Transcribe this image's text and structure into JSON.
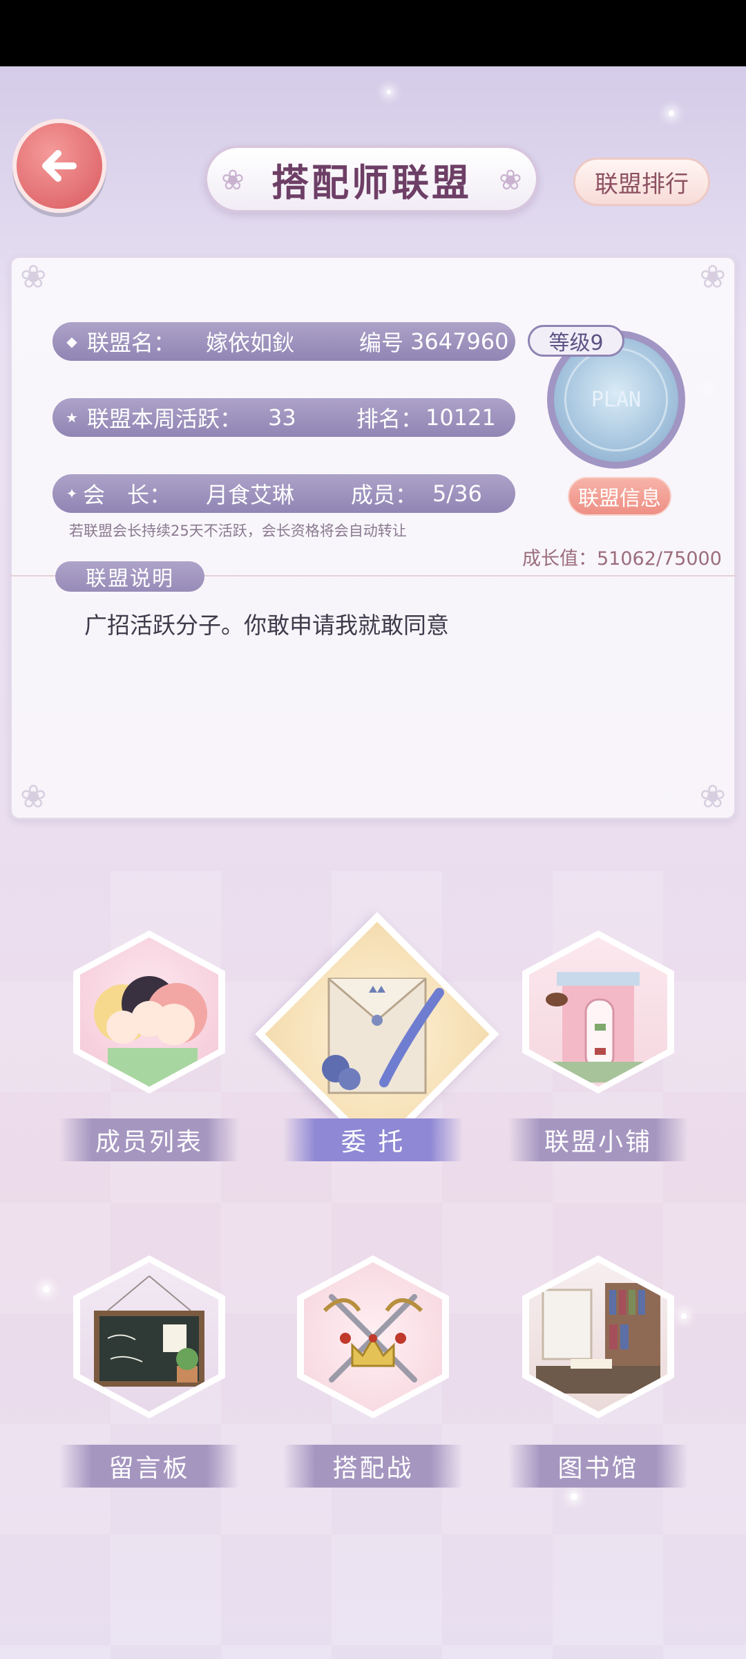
{
  "header": {
    "title": "搭配师联盟",
    "rank_button": "联盟排行"
  },
  "alliance": {
    "name_label": "联盟名：",
    "name_value": "嫁依如鈥",
    "id_label": "编号",
    "id_value": "3647960",
    "activity_label": "联盟本周活跃：",
    "activity_value": "33",
    "rank_label": "排名：",
    "rank_value": "10121",
    "leader_label": "会　长：",
    "leader_value": "月食艾琳",
    "members_label": "成员：",
    "members_value": "5/36",
    "level": "等级9",
    "emblem_text": "PLAN",
    "info_button": "联盟信息",
    "notice": "若联盟会长持续25天不活跃，会长资格将会自动转让",
    "growth": "成长值：51062/75000"
  },
  "description": {
    "label": "联盟说明",
    "text": "广招活跃分子。你敢申请我就敢同意"
  },
  "features": [
    {
      "label": "成员列表",
      "icon": "members-icon"
    },
    {
      "label": "委  托",
      "icon": "commission-icon"
    },
    {
      "label": "联盟小铺",
      "icon": "shop-icon"
    },
    {
      "label": "留言板",
      "icon": "message-board-icon"
    },
    {
      "label": "搭配战",
      "icon": "battle-icon"
    },
    {
      "label": "图书馆",
      "icon": "library-icon"
    }
  ]
}
